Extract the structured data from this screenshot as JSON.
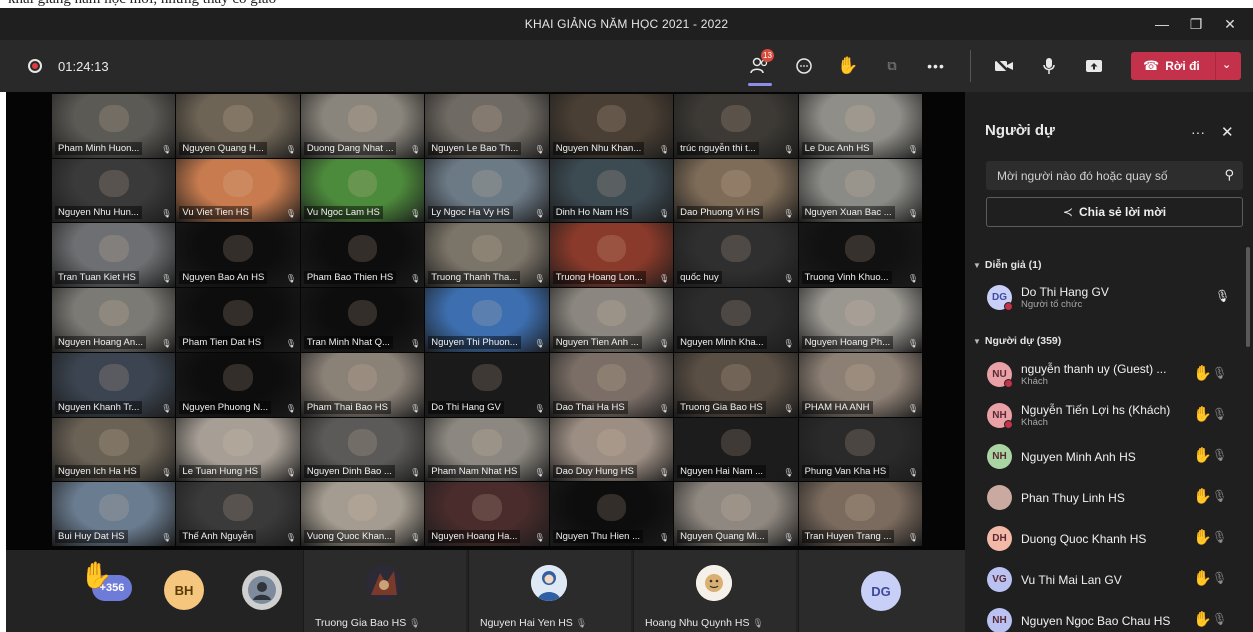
{
  "window": {
    "title": "KHAI GIẢNG NĂM HỌC 2021 - 2022",
    "top_caption": "khai giảng năm học mới, những thầy cô giáo"
  },
  "toolbar": {
    "timer": "01:24:13",
    "participants_badge": "13",
    "leave_label": "Rời đi"
  },
  "grid": {
    "tiles": [
      {
        "name": "Pham Minh Huon...",
        "bg": "#5b5a55"
      },
      {
        "name": "Nguyen Quang H...",
        "bg": "#6e6455"
      },
      {
        "name": "Duong Dang Nhat ...",
        "bg": "#8a857c"
      },
      {
        "name": "Nguyen Le Bao Th...",
        "bg": "#6f6a63"
      },
      {
        "name": "Nguyen Nhu Khan...",
        "bg": "#4a3f34"
      },
      {
        "name": "trúc nguyễn thi t...",
        "bg": "#3d3a35"
      },
      {
        "name": "Le Duc Anh HS",
        "bg": "#8f8e88"
      },
      {
        "name": "Nguyen Nhu Hun...",
        "bg": "#3a3a3a"
      },
      {
        "name": "Vu Viet Tien HS",
        "bg": "#c77b4e"
      },
      {
        "name": "Vu Ngoc Lam HS",
        "bg": "#4d8b3c"
      },
      {
        "name": "Ly Ngoc Ha Vy HS",
        "bg": "#6c7a86"
      },
      {
        "name": "Dinh Ho Nam HS",
        "bg": "#3c4a52"
      },
      {
        "name": "Dao Phuong Vi HS",
        "bg": "#7e6c58"
      },
      {
        "name": "Nguyen Xuan Bac ...",
        "bg": "#8a8a86"
      },
      {
        "name": "Tran Tuan Kiet HS",
        "bg": "#6d6f72"
      },
      {
        "name": "Nguyen Bao An HS",
        "bg": "#0d0d0d"
      },
      {
        "name": "Pham Bao Thien HS",
        "bg": "#0d0d0d"
      },
      {
        "name": "Truong Thanh Tha...",
        "bg": "#7b7468"
      },
      {
        "name": "Truong Hoang Lon...",
        "bg": "#8a3a2a"
      },
      {
        "name": "quốc huy",
        "bg": "#2f2f2f"
      },
      {
        "name": "Truong Vinh Khuo...",
        "bg": "#111111"
      },
      {
        "name": "Nguyen Hoang An...",
        "bg": "#7c7a74"
      },
      {
        "name": "Pham Tien Dat HS",
        "bg": "#0d0d0d"
      },
      {
        "name": "Tran Minh Nhat Q...",
        "bg": "#0d0d0d"
      },
      {
        "name": "Nguyen Thi Phuon...",
        "bg": "#3d6fb0"
      },
      {
        "name": "Nguyen Tien Anh ...",
        "bg": "#8b8780"
      },
      {
        "name": "Nguyen Minh Kha...",
        "bg": "#2c2c2c"
      },
      {
        "name": "Nguyen Hoang Ph...",
        "bg": "#9a9791"
      },
      {
        "name": "Nguyen Khanh Tr...",
        "bg": "#3b4450"
      },
      {
        "name": "Nguyen Phuong N...",
        "bg": "#0d0d0d"
      },
      {
        "name": "Pham Thai Bao HS",
        "bg": "#8a8177"
      },
      {
        "name": "Do Thi Hang GV",
        "bg": "#1a1a1a"
      },
      {
        "name": "Dao Thai Ha HS",
        "bg": "#7a6e66"
      },
      {
        "name": "Truong Gia Bao HS",
        "bg": "#5a4f44"
      },
      {
        "name": "PHAM HA ANH",
        "bg": "#8c7f74"
      },
      {
        "name": "Nguyen Ich Ha HS",
        "bg": "#6b6256"
      },
      {
        "name": "Le Tuan Hung HS",
        "bg": "#a79f96"
      },
      {
        "name": "Nguyen Dinh Bao ...",
        "bg": "#5b5a58"
      },
      {
        "name": "Pham Nam Nhat HS",
        "bg": "#8c8881"
      },
      {
        "name": "Dao Duy Hung HS",
        "bg": "#9c8e83"
      },
      {
        "name": "Nguyen Hai Nam ...",
        "bg": "#1c1c1c"
      },
      {
        "name": "Phung Van Kha HS",
        "bg": "#2a2a2a"
      },
      {
        "name": "Bui Huy Dat HS",
        "bg": "#6a7c90"
      },
      {
        "name": "Thế Anh Nguyễn",
        "bg": "#3a3a3a"
      },
      {
        "name": "Vuong Quoc Khan...",
        "bg": "#a49c90"
      },
      {
        "name": "Nguyen Hoang Ha...",
        "bg": "#4a2c2c"
      },
      {
        "name": "Nguyen Thu Hien ...",
        "bg": "#0d0d0d"
      },
      {
        "name": "Nguyen Quang Mi...",
        "bg": "#8f8880"
      },
      {
        "name": "Tran Huyen Trang ...",
        "bg": "#7b6b5e"
      }
    ]
  },
  "bottom": {
    "raised_count": "+356",
    "avatar_bh": "BH",
    "avatar_dg": "DG",
    "tiles": [
      {
        "name": "Truong Gia Bao HS"
      },
      {
        "name": "Nguyen Hai Yen HS"
      },
      {
        "name": "Hoang Nhu Quynh HS"
      }
    ]
  },
  "panel": {
    "title": "Người dự",
    "invite_placeholder": "Mời người nào đó hoặc quay số",
    "share_label": "Chia sẻ lời mời",
    "presenters_header": "Diễn giả (1)",
    "attendees_header": "Người dự (359)",
    "presenter": {
      "initials": "DG",
      "name": "Do Thi Hang GV",
      "role": "Người tổ chức"
    },
    "attendees": [
      {
        "initials": "NU",
        "name": "nguyễn thanh uy (Guest) ...",
        "role": "Khách",
        "color": "#e9a0a6"
      },
      {
        "initials": "NH",
        "name": "Nguyễn Tiến Lợi hs (Khách)",
        "role": "Khách",
        "color": "#e9a0a6"
      },
      {
        "initials": "NH",
        "name": "Nguyen Minh Anh HS",
        "role": "",
        "color": "#a8d5a2"
      },
      {
        "initials": "",
        "name": "Phan Thuy Linh HS",
        "role": "",
        "color": "#c9a9a0"
      },
      {
        "initials": "DH",
        "name": "Duong Quoc Khanh HS",
        "role": "",
        "color": "#f2b8a8"
      },
      {
        "initials": "VG",
        "name": "Vu Thi Mai Lan GV",
        "role": "",
        "color": "#b9c2f0"
      },
      {
        "initials": "NH",
        "name": "Nguyen Ngoc Bao Chau HS",
        "role": "",
        "color": "#b9c2f0"
      }
    ]
  }
}
